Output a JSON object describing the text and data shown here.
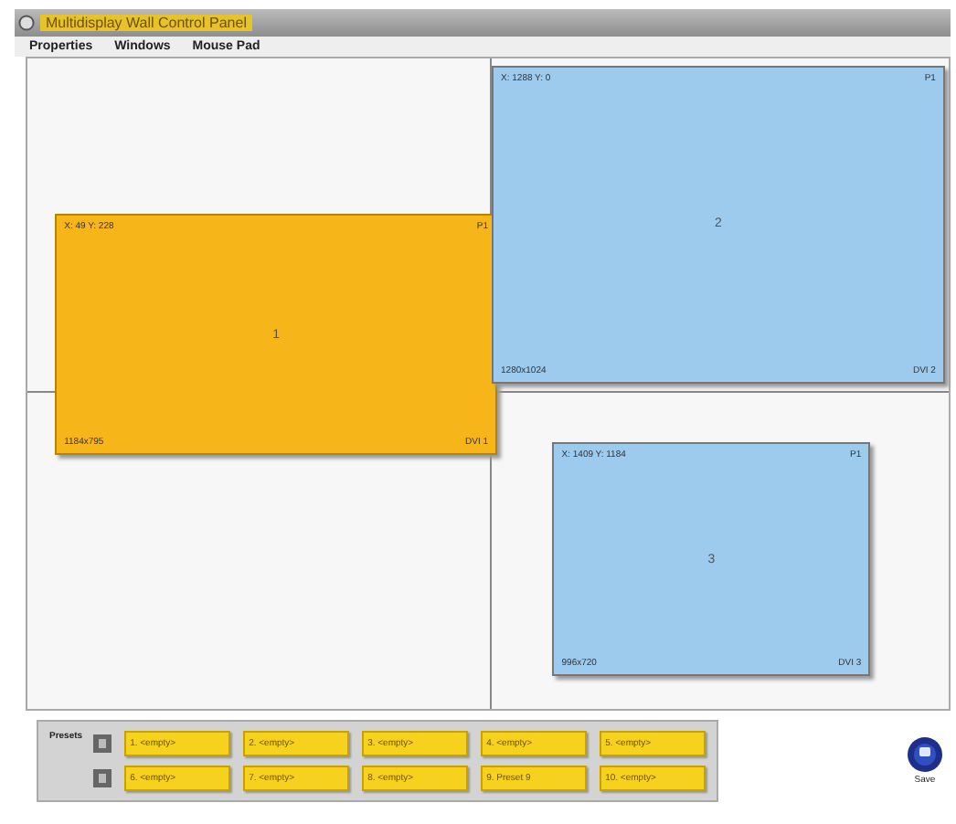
{
  "window": {
    "title": "Multidisplay Wall Control Panel"
  },
  "menu": [
    "Properties",
    "Windows",
    "Mouse Pad"
  ],
  "display_windows": [
    {
      "position": "X: 49 Y: 228",
      "page": "P1",
      "number": "1",
      "size": "1184x795",
      "source": "DVI 1",
      "selected": true
    },
    {
      "position": "X: 1288 Y: 0",
      "page": "P1",
      "number": "2",
      "size": "1280x1024",
      "source": "DVI 2",
      "selected": false
    },
    {
      "position": "X: 1409 Y: 1184",
      "page": "P1",
      "number": "3",
      "size": "996x720",
      "source": "DVI 3",
      "selected": false
    }
  ],
  "presets": {
    "label": "Presets",
    "rows": [
      [
        "1. <empty>",
        "2. <empty>",
        "3. <empty>",
        "4. <empty>",
        "5. <empty>"
      ],
      [
        "6. <empty>",
        "7. <empty>",
        "8. <empty>",
        "9. Preset 9",
        "10. <empty>"
      ]
    ]
  },
  "save": {
    "label": "Save"
  }
}
